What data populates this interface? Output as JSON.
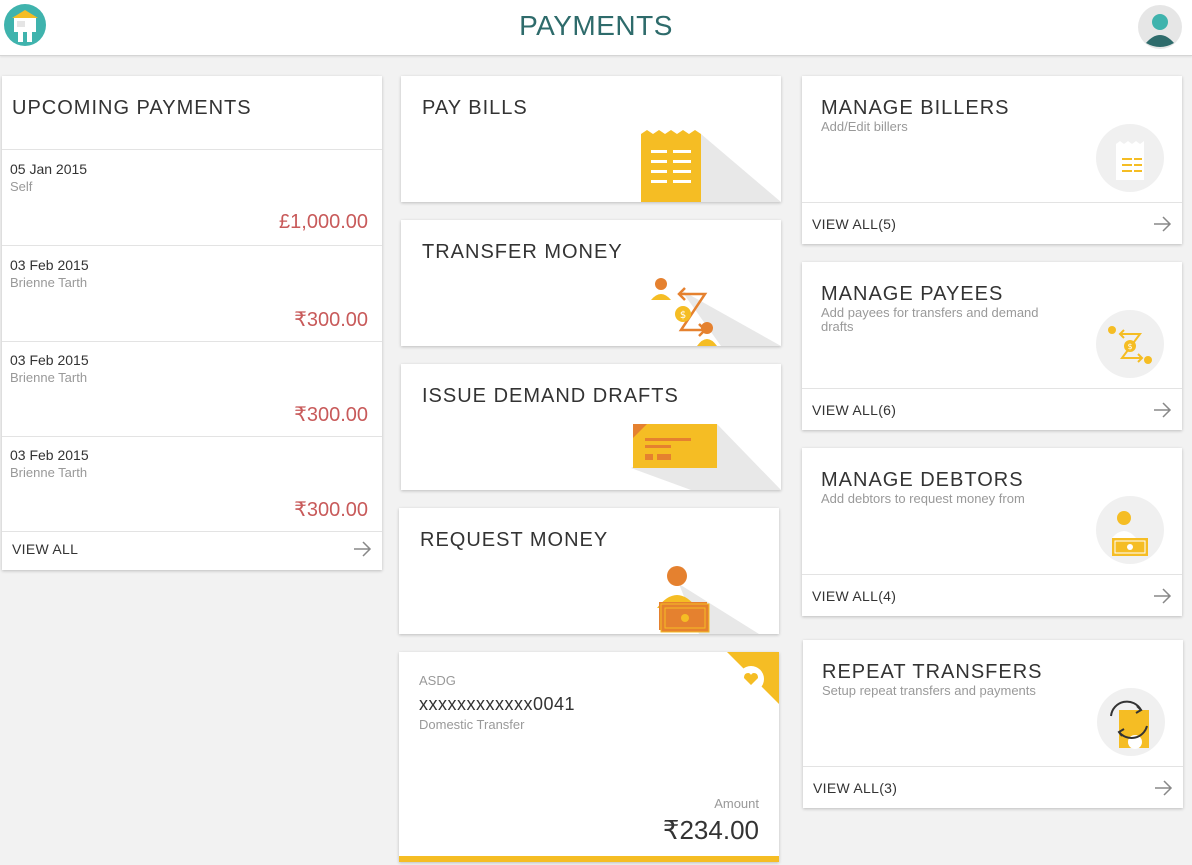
{
  "header": {
    "title": "PAYMENTS"
  },
  "upcoming": {
    "title": "UPCOMING PAYMENTS",
    "rows": [
      {
        "date": "05 Jan 2015",
        "name": "Self",
        "amount": "£1,000.00"
      },
      {
        "date": "03 Feb 2015",
        "name": "Brienne Tarth",
        "amount": "₹300.00"
      },
      {
        "date": "03 Feb 2015",
        "name": "Brienne Tarth",
        "amount": "₹300.00"
      },
      {
        "date": "03 Feb 2015",
        "name": "Brienne Tarth",
        "amount": "₹300.00"
      }
    ],
    "view_all": "VIEW ALL"
  },
  "actions": {
    "pay_bills": "PAY BILLS",
    "transfer_money": "TRANSFER MONEY",
    "issue_drafts": "ISSUE DEMAND DRAFTS",
    "request_money": "REQUEST MONEY"
  },
  "favourite": {
    "label": "ASDG",
    "account": "xxxxxxxxxxxx0041",
    "type": "Domestic Transfer",
    "amount_label": "Amount",
    "amount": "₹234.00"
  },
  "manage": {
    "billers": {
      "title": "MANAGE BILLERS",
      "subtitle": "Add/Edit billers",
      "view_all": "VIEW ALL(5)"
    },
    "payees": {
      "title": "MANAGE PAYEES",
      "subtitle": "Add payees for transfers and demand drafts",
      "view_all": "VIEW ALL(6)"
    },
    "debtors": {
      "title": "MANAGE DEBTORS",
      "subtitle": "Add debtors to request money from",
      "view_all": "VIEW ALL(4)"
    },
    "repeat": {
      "title": "REPEAT TRANSFERS",
      "subtitle": "Setup repeat transfers and payments",
      "view_all": "VIEW ALL(3)"
    }
  },
  "colors": {
    "accent": "#f5bd24",
    "orange": "#e5812f",
    "teal": "#2e6b6b",
    "amount_red": "#c85a5a"
  }
}
